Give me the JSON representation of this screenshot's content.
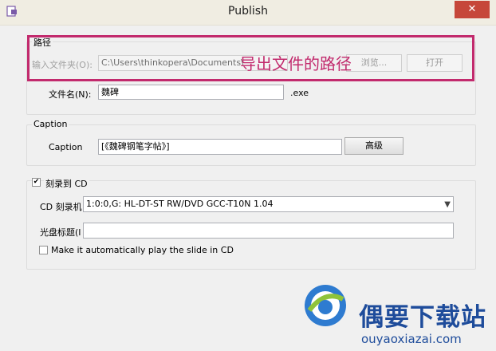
{
  "window": {
    "title": "Publish",
    "close_glyph": "✕",
    "app_icon": "document-icon"
  },
  "path_group": {
    "legend": "路径",
    "folder_label": "输入文件夹(O):",
    "folder_value": "C:\\Users\\thinkopera\\Documents\\",
    "browse_label": "浏览...",
    "open_label": "打开",
    "filename_label": "文件名(N):",
    "filename_value": "魏碑",
    "extension": ".exe"
  },
  "annotation": {
    "text": "导出文件的路径",
    "color": "#c22a6d"
  },
  "caption_group": {
    "legend": "Caption",
    "caption_label": "Caption",
    "caption_value": "[《魏碑钢笔字帖》]",
    "advanced_label": "高级"
  },
  "cd_group": {
    "burn_checkbox_label": "刻录到 CD",
    "burn_checked": true,
    "burner_label": "CD 刻录机",
    "burner_value": "1:0:0,G: HL-DT-ST RW/DVD GCC-T10N  1.04",
    "disc_title_label": "光盘标题(I",
    "disc_title_value": "",
    "autoplay_label": "Make it automatically play the  slide in CD",
    "autoplay_checked": false
  },
  "watermark": {
    "name": "偶要下载站",
    "url": "ouyaoxiazai.com",
    "brand_color": "#1e4c9b"
  }
}
